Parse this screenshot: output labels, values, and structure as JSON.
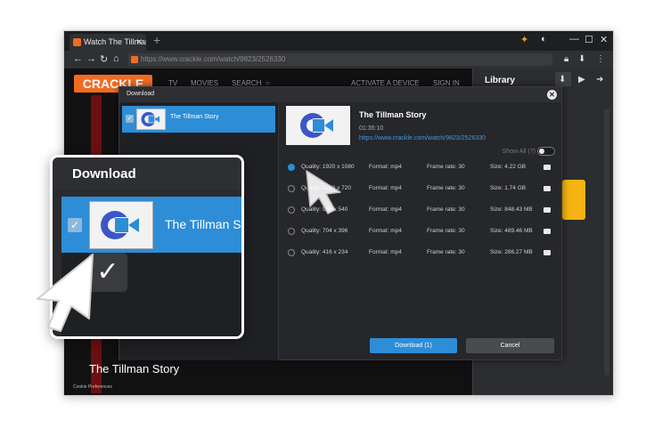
{
  "browser": {
    "tab_title": "Watch The Tillman St",
    "tab_close": "✕",
    "new_tab": "+",
    "url": "https://www.crackle.com/watch/9823/2526330"
  },
  "site": {
    "logo": "CRACKLE",
    "nav": [
      "TV",
      "MOVIES",
      "SEARCH",
      "ACTIVATE A DEVICE",
      "SIGN IN"
    ],
    "title": "The Tillman Story",
    "cookie": "Cookie Preferences",
    "brand_color": "#f26b21"
  },
  "library": {
    "title": "Library"
  },
  "dialog": {
    "title": "Download",
    "close": "✕",
    "list_item": "The Tillman Story",
    "video": {
      "title": "The Tillman Story",
      "duration": "01:35:10",
      "url": "https://www.crackle.com/watch/9823/2526330"
    },
    "show_all": "Show All (7)",
    "qualities": [
      {
        "quality": "Quality: 1920 x 1080",
        "format": "Format: mp4",
        "frame_rate": "Frame rate: 30",
        "size": "Size: 4.22 GB",
        "selected": true
      },
      {
        "quality": "Quality: 1280 x 720",
        "format": "Format: mp4",
        "frame_rate": "Frame rate: 30",
        "size": "Size: 1.74 GB",
        "selected": false
      },
      {
        "quality": "Quality: 960 x 540",
        "format": "Format: mp4",
        "frame_rate": "Frame rate: 30",
        "size": "Size: 848.43 MB",
        "selected": false
      },
      {
        "quality": "Quality: 704 x 396",
        "format": "Format: mp4",
        "frame_rate": "Frame rate: 30",
        "size": "Size: 489.46 MB",
        "selected": false
      },
      {
        "quality": "Quality: 416 x 234",
        "format": "Format: mp4",
        "frame_rate": "Frame rate: 30",
        "size": "Size: 286.27 MB",
        "selected": false
      }
    ],
    "download_button": "Download (1)",
    "cancel_button": "Cancel",
    "accent_color": "#2d8dd6"
  },
  "zoom": {
    "title": "Download",
    "list_item": "The Tillman St"
  }
}
